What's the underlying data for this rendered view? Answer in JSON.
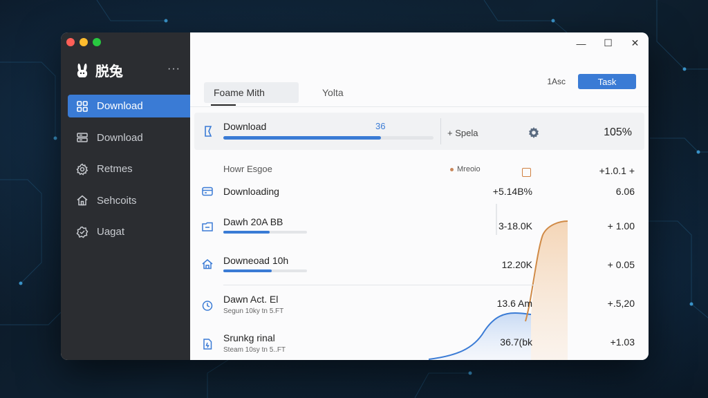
{
  "app": {
    "name": "脱兔",
    "more": "···"
  },
  "sidebar": {
    "items": [
      {
        "label": "Download",
        "icon": "grid-icon",
        "active": true
      },
      {
        "label": "Download",
        "icon": "server-icon",
        "active": false
      },
      {
        "label": "Retmes",
        "icon": "gear-icon",
        "active": false
      },
      {
        "label": "Sehcoits",
        "icon": "home-icon",
        "active": false
      },
      {
        "label": "Uagat",
        "icon": "badge-icon",
        "active": false
      }
    ]
  },
  "window_controls": {
    "minimize": "—",
    "maximize": "☐",
    "close": "✕"
  },
  "header": {
    "tabs": [
      {
        "label": "Foame Mith",
        "active": true
      },
      {
        "label": "Yolta",
        "active": false
      }
    ],
    "asc_label": "1Asc",
    "task_button": "Task"
  },
  "active_download": {
    "label": "Download",
    "count": "36",
    "progress": 0.75,
    "speed_label": "+ Spela",
    "percent": "105%"
  },
  "list_header": {
    "title": "Howr Esgoe",
    "legend": "Mreoio",
    "top_value": "+1.0.1 +"
  },
  "rows": [
    {
      "label": "Downloading",
      "icon": "card-icon",
      "size": "+5.14B%",
      "delta": "6.06",
      "progress": null,
      "sub": null
    },
    {
      "label": "Dawh 20A BB",
      "icon": "folder-icon",
      "size": "3-18.0K",
      "delta": "+ 1.00",
      "progress": 0.55,
      "sub": null
    },
    {
      "label": "Downeoad 10h",
      "icon": "house-icon",
      "size": "12.20K",
      "delta": "+ 0.05",
      "progress": 0.58,
      "sub": null
    },
    {
      "label": "Dawn Act. El",
      "icon": "clock-icon",
      "size": "13.6 Am",
      "delta": "+.5,20",
      "progress": null,
      "sub": "Segun 10ky tn 5.FT"
    },
    {
      "label": "Srunkg rinal",
      "icon": "file-icon",
      "size": "36.7(bk",
      "delta": "+1.03",
      "progress": null,
      "sub": "Steam 10sy tn 5..FT"
    }
  ],
  "colors": {
    "accent": "#3a7bd5",
    "sidebar_bg": "#2b2d31",
    "chart_orange": "#d08a46",
    "chart_blue": "#3a7bd5"
  }
}
